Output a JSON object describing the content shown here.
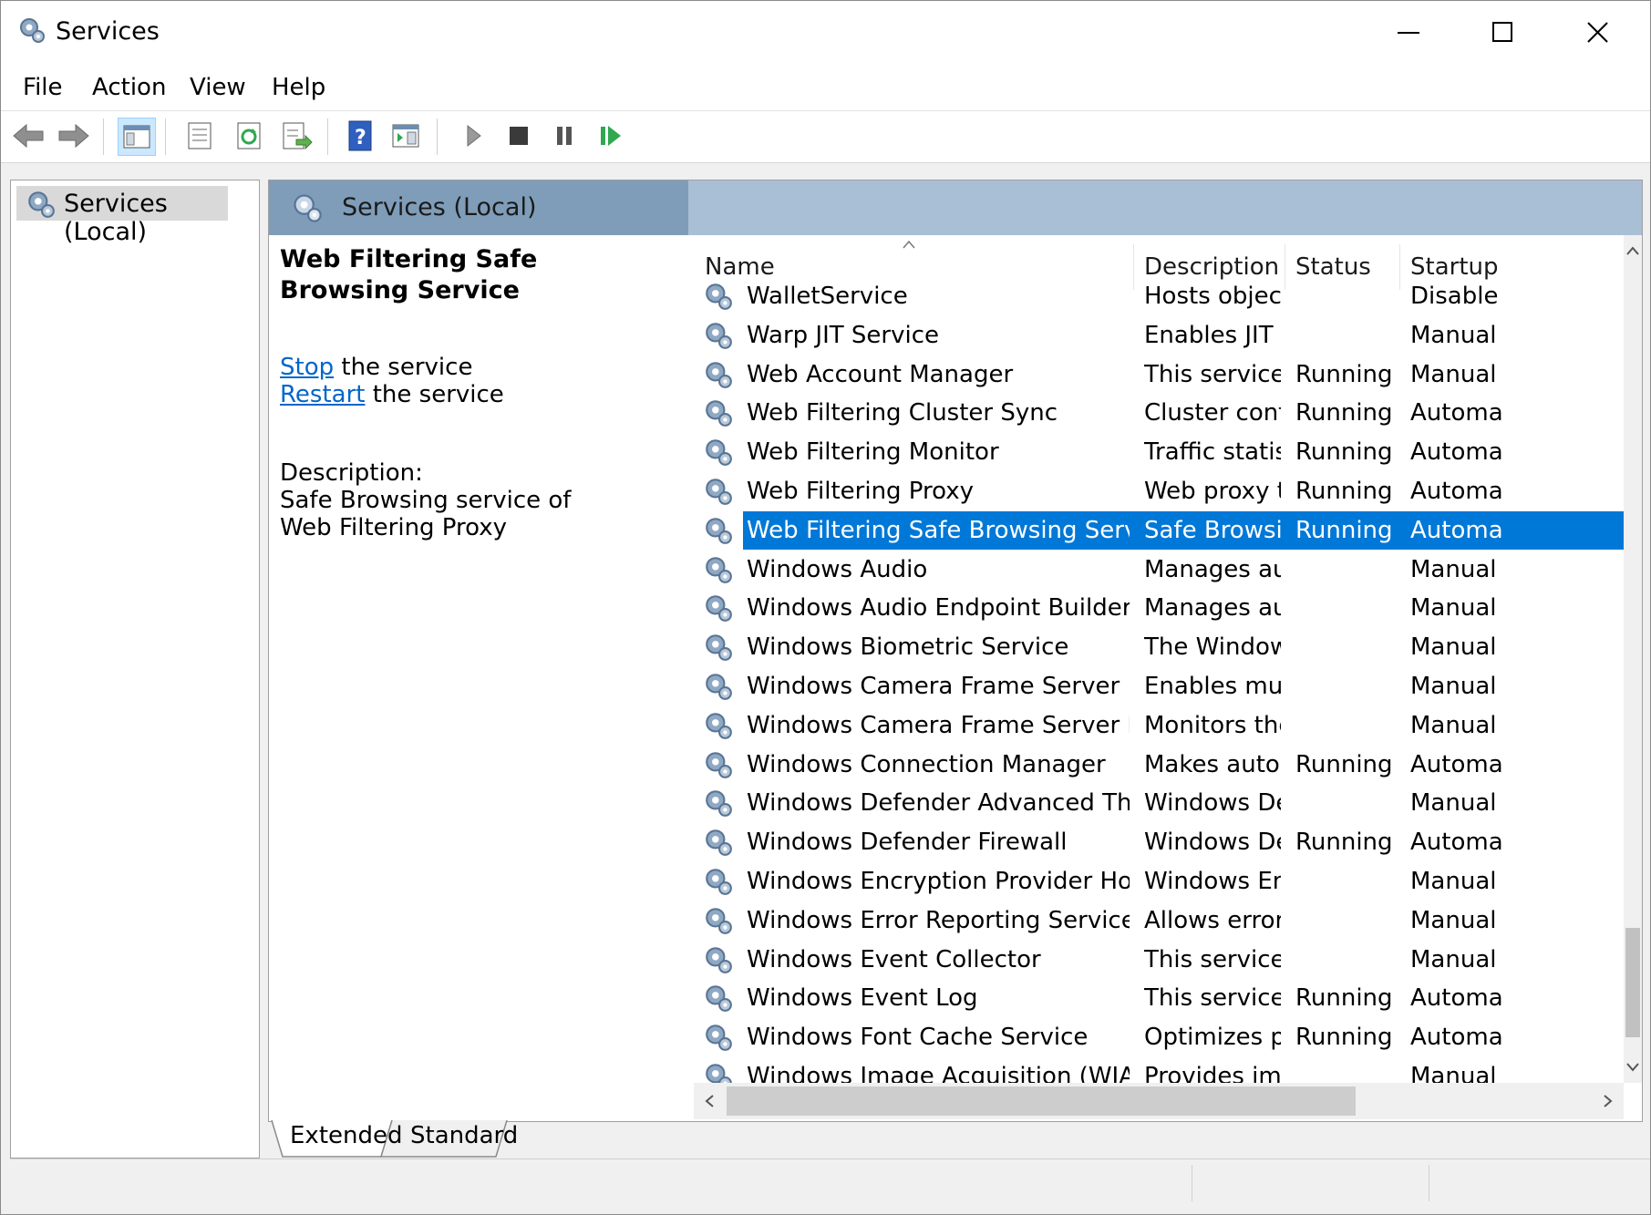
{
  "window": {
    "title": "Services",
    "minimize_icon": "minimize-icon",
    "maximize_icon": "maximize-icon",
    "close_icon": "close-icon"
  },
  "menu": {
    "items": [
      "File",
      "Action",
      "View",
      "Help"
    ]
  },
  "toolbar": {
    "buttons": [
      "back",
      "forward",
      "show-hide-console-tree",
      "properties",
      "refresh",
      "export-list",
      "help",
      "show-action-pane",
      "start-service",
      "stop-service",
      "pause-service",
      "resume-service"
    ]
  },
  "tree": {
    "root_label": "Services (Local)"
  },
  "main": {
    "header_label": "Services (Local)",
    "selected_service": {
      "name": "Web Filtering Safe Browsing Service",
      "stop_link": "Stop",
      "stop_suffix": " the service",
      "restart_link": "Restart",
      "restart_suffix": " the service",
      "description_label": "Description:",
      "description_text": "Safe Browsing service of Web Filtering Proxy"
    },
    "columns": [
      "Name",
      "Description",
      "Status",
      "Startup"
    ],
    "rows": [
      {
        "name": "WalletService",
        "description": "Hosts object...",
        "status": "",
        "startup": "Disable"
      },
      {
        "name": "Warp JIT Service",
        "description": "Enables JIT c...",
        "status": "",
        "startup": "Manual"
      },
      {
        "name": "Web Account Manager",
        "description": "This service i...",
        "status": "Running",
        "startup": "Manual"
      },
      {
        "name": "Web Filtering Cluster Sync",
        "description": "Cluster confi...",
        "status": "Running",
        "startup": "Automa"
      },
      {
        "name": "Web Filtering Monitor",
        "description": "Traffic statist...",
        "status": "Running",
        "startup": "Automa"
      },
      {
        "name": "Web Filtering Proxy",
        "description": "Web proxy t...",
        "status": "Running",
        "startup": "Automa"
      },
      {
        "name": "Web Filtering Safe Browsing Service",
        "description": "Safe Browsin...",
        "status": "Running",
        "startup": "Automa",
        "selected": true
      },
      {
        "name": "Windows Audio",
        "description": "Manages au...",
        "status": "",
        "startup": "Manual"
      },
      {
        "name": "Windows Audio Endpoint Builder",
        "description": "Manages au...",
        "status": "",
        "startup": "Manual"
      },
      {
        "name": "Windows Biometric Service",
        "description": "The Window...",
        "status": "",
        "startup": "Manual"
      },
      {
        "name": "Windows Camera Frame Server",
        "description": "Enables mult...",
        "status": "",
        "startup": "Manual"
      },
      {
        "name": "Windows Camera Frame Server Monitor",
        "description": "Monitors the...",
        "status": "",
        "startup": "Manual"
      },
      {
        "name": "Windows Connection Manager",
        "description": "Makes auto...",
        "status": "Running",
        "startup": "Automa"
      },
      {
        "name": "Windows Defender Advanced Threat Prote...",
        "description": "Windows De...",
        "status": "",
        "startup": "Manual"
      },
      {
        "name": "Windows Defender Firewall",
        "description": "Windows De...",
        "status": "Running",
        "startup": "Automa"
      },
      {
        "name": "Windows Encryption Provider Host Service",
        "description": "Windows En...",
        "status": "",
        "startup": "Manual"
      },
      {
        "name": "Windows Error Reporting Service",
        "description": "Allows error...",
        "status": "",
        "startup": "Manual"
      },
      {
        "name": "Windows Event Collector",
        "description": "This service ...",
        "status": "",
        "startup": "Manual"
      },
      {
        "name": "Windows Event Log",
        "description": "This service ...",
        "status": "Running",
        "startup": "Automa"
      },
      {
        "name": "Windows Font Cache Service",
        "description": "Optimizes p...",
        "status": "Running",
        "startup": "Automa"
      },
      {
        "name": "Windows Image Acquisition (WIA)",
        "description": "Provides ima...",
        "status": "",
        "startup": "Manual"
      }
    ]
  },
  "tabs": [
    "Extended",
    "Standard"
  ],
  "colors": {
    "selection": "#0078d7",
    "header_band": "#a9bfd6",
    "link": "#0066cc"
  }
}
